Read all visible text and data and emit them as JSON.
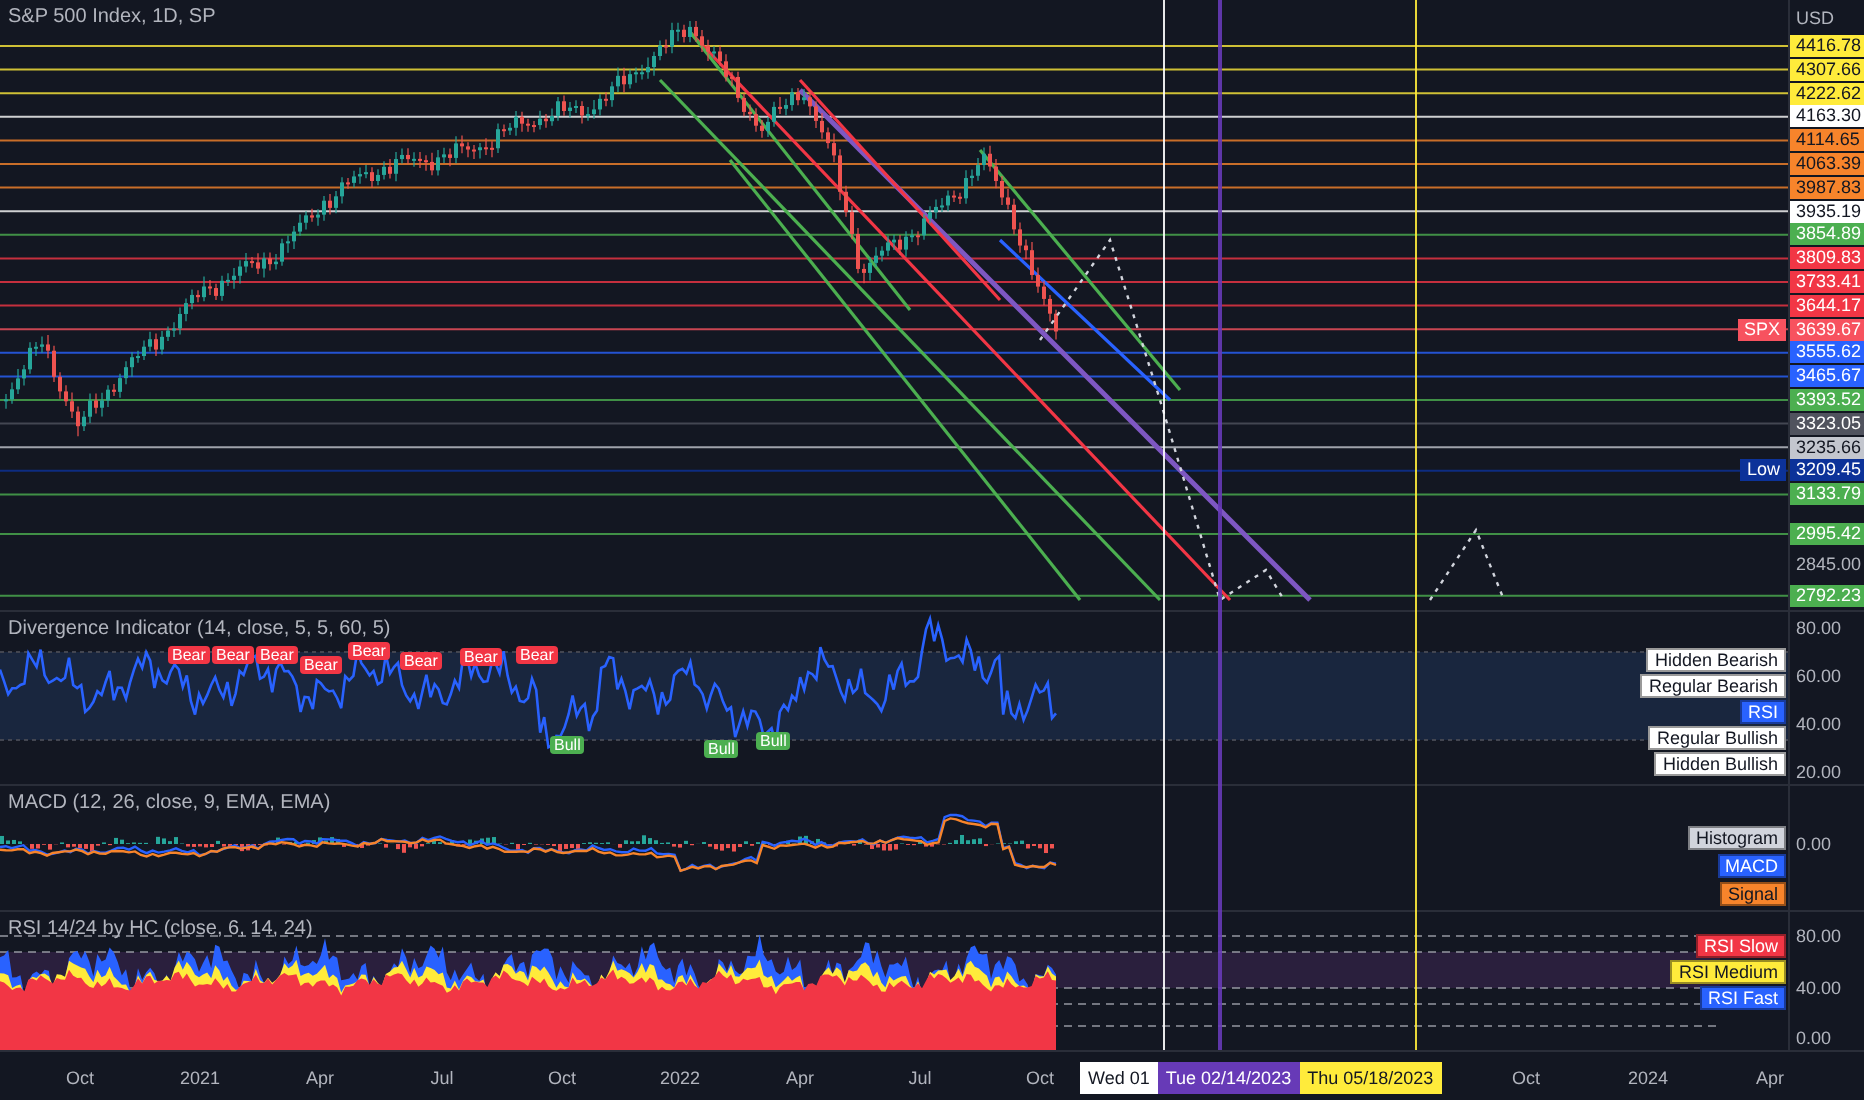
{
  "main": {
    "title": "S&P 500 Index, 1D, SP",
    "currency": "USD",
    "price_tags": [
      {
        "value": "4416.78",
        "color": "#ffeb3b"
      },
      {
        "value": "4307.66",
        "color": "#ffeb3b"
      },
      {
        "value": "4222.62",
        "color": "#ffeb3b"
      },
      {
        "value": "4163.30",
        "color": "#ffffff"
      },
      {
        "value": "4114.65",
        "color": "#f7842b"
      },
      {
        "value": "4063.39",
        "color": "#f7842b"
      },
      {
        "value": "3987.83",
        "color": "#f7842b"
      },
      {
        "value": "3935.19",
        "color": "#ffffff"
      },
      {
        "value": "3854.89",
        "color": "#4caf50"
      },
      {
        "value": "3809.83",
        "color": "#f23645"
      },
      {
        "value": "3733.41",
        "color": "#f23645"
      },
      {
        "value": "3644.17",
        "color": "#f23645"
      },
      {
        "value": "3639.67",
        "color": "#f7525f",
        "side_label": "SPX"
      },
      {
        "value": "3555.62",
        "color": "#2962ff"
      },
      {
        "value": "3465.67",
        "color": "#2962ff"
      },
      {
        "value": "3393.52",
        "color": "#4caf50"
      },
      {
        "value": "3323.05",
        "color": "#50535e"
      },
      {
        "value": "3235.66",
        "color": "#c3c6ce"
      },
      {
        "value": "3209.45",
        "color": "#0c3299",
        "side_label": "Low"
      },
      {
        "value": "3133.79",
        "color": "#4caf50"
      },
      {
        "value": "2995.42",
        "color": "#4caf50"
      },
      {
        "value": "2792.23",
        "color": "#4caf50"
      }
    ],
    "axis_ticks": [
      "2845.00"
    ]
  },
  "panes": [
    {
      "kind": "divergence",
      "legend": "Divergence Indicator (14, close, 5, 5, 60, 5)",
      "axis_ticks": [
        "80.00",
        "60.00",
        "40.00",
        "20.00"
      ],
      "tags": [
        {
          "label": "Hidden Bearish",
          "color": "#ffffff"
        },
        {
          "label": "Regular Bearish",
          "color": "#ffffff"
        },
        {
          "label": "RSI",
          "color": "#2962ff"
        },
        {
          "label": "Regular Bullish",
          "color": "#ffffff"
        },
        {
          "label": "Hidden Bullish",
          "color": "#ffffff"
        }
      ],
      "markers": [
        {
          "text": "Bear",
          "kind": "bear"
        },
        {
          "text": "Bear",
          "kind": "bear"
        },
        {
          "text": "Bear",
          "kind": "bear"
        },
        {
          "text": "Bear",
          "kind": "bear"
        },
        {
          "text": "Bear",
          "kind": "bear"
        },
        {
          "text": "Bear",
          "kind": "bear"
        },
        {
          "text": "Bear",
          "kind": "bear"
        },
        {
          "text": "Bear",
          "kind": "bear"
        },
        {
          "text": "Bull",
          "kind": "bull"
        },
        {
          "text": "Bull",
          "kind": "bull"
        },
        {
          "text": "Bull",
          "kind": "bull"
        }
      ]
    },
    {
      "kind": "macd",
      "legend": "MACD (12, 26, close, 9, EMA, EMA)",
      "axis_ticks": [
        "0.00"
      ],
      "tags": [
        {
          "label": "Histogram",
          "color": "#d1d4dc"
        },
        {
          "label": "MACD",
          "color": "#2962ff"
        },
        {
          "label": "Signal",
          "color": "#f7842b"
        }
      ]
    },
    {
      "kind": "rsi_bands",
      "legend": "RSI 14/24 by HC (close, 6, 14, 24)",
      "axis_ticks": [
        "80.00",
        "40.00",
        "0.00"
      ],
      "tags": [
        {
          "label": "RSI Slow",
          "color": "#f23645"
        },
        {
          "label": "RSI Medium",
          "color": "#ffeb3b"
        },
        {
          "label": "RSI Fast",
          "color": "#2962ff"
        }
      ]
    }
  ],
  "time_axis": {
    "labels": [
      "Oct",
      "2021",
      "Apr",
      "Jul",
      "Oct",
      "2022",
      "Apr",
      "Jul",
      "Oct",
      "Oct",
      "2024",
      "Apr"
    ],
    "date_markers": [
      {
        "label": "Wed 01",
        "color": "#ffffff"
      },
      {
        "label": "Tue 02/14/2023",
        "color": "#673ab7"
      },
      {
        "label": "Thu 05/18/2023",
        "color": "#ffeb3b"
      }
    ]
  }
}
